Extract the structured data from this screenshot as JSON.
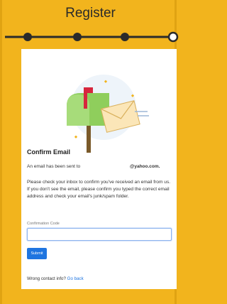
{
  "header": {
    "title": "Register"
  },
  "stepper": {
    "steps": [
      {
        "state": "complete"
      },
      {
        "state": "complete"
      },
      {
        "state": "complete"
      },
      {
        "state": "current"
      }
    ],
    "accent_color": "#2b2b2b"
  },
  "card": {
    "heading": "Confirm Email",
    "sent_prefix": "An email has been sent to",
    "email_domain": "@yahoo.com.",
    "message": "Please check your inbox to confirm you've received an email from us. If you don't see the email, please confirm you typed the correct email address and check your email's junk/spam folder.",
    "code_label": "Confirmation Code",
    "code_value": "",
    "submit_label": "Submit",
    "wrong_prompt": "Wrong contact info?",
    "go_back_label": "Go back"
  },
  "colors": {
    "background": "#f2b41d",
    "button": "#1f75e0",
    "link": "#1f75e0"
  }
}
